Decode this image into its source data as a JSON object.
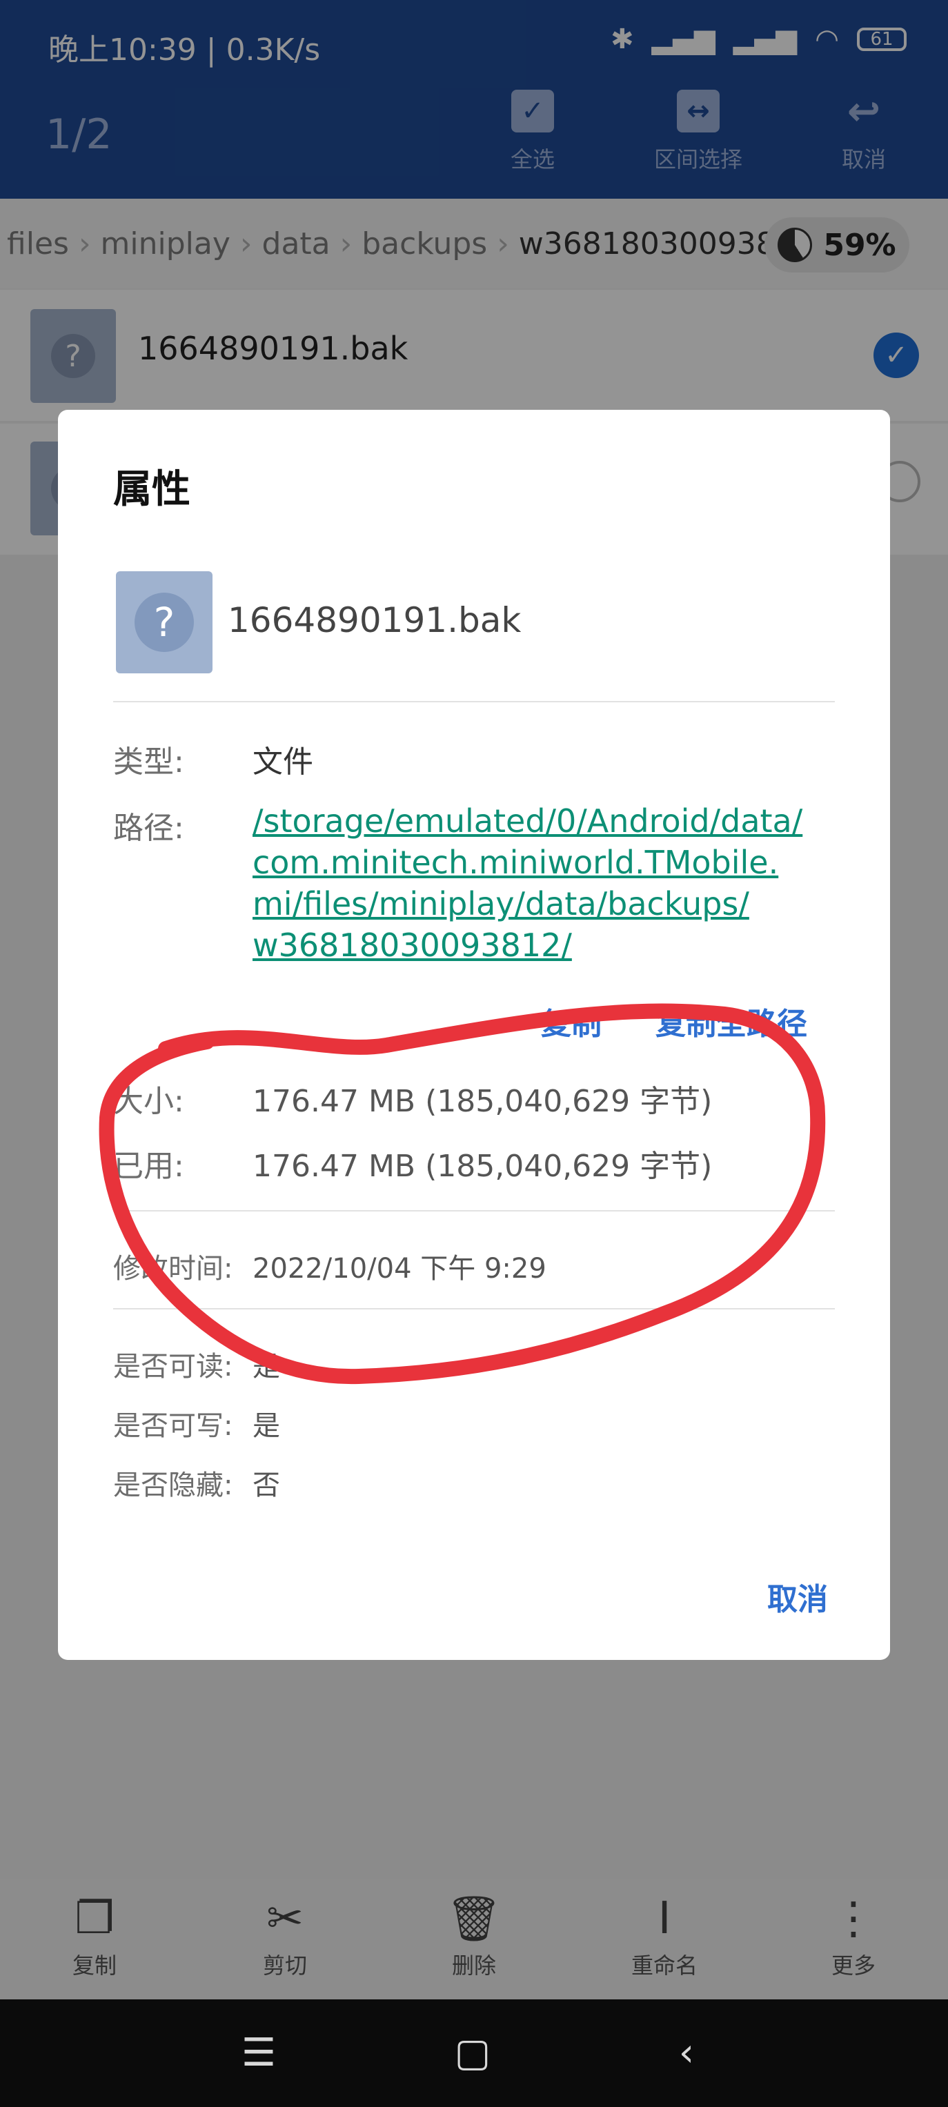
{
  "status_bar": {
    "time": "晚上10:39 | 0.3K/s",
    "battery": "61"
  },
  "header": {
    "selection_count": "1/2",
    "actions": [
      {
        "label": "全选"
      },
      {
        "label": "区间选择"
      },
      {
        "label": "取消"
      }
    ]
  },
  "breadcrumb": {
    "items": [
      "files",
      "miniplay",
      "data",
      "backups",
      "w36818030093812"
    ],
    "storage_percent": "59%"
  },
  "file_list": [
    {
      "name": "1664890191.bak",
      "selected": true
    }
  ],
  "dialog": {
    "title": "属性",
    "file_name": "1664890191.bak",
    "type_label": "类型:",
    "type_value": "文件",
    "path_label": "路径:",
    "path_lines": [
      "/storage/emulated/0/Android/data/",
      "com.minitech.miniworld.TMobile.",
      "mi/files/miniplay/data/backups/",
      "w36818030093812/"
    ],
    "copy_label": "复制",
    "copy_full_label": "复制全路径",
    "size_label": "大小:",
    "size_value": "176.47 MB (185,040,629 字节)",
    "used_label": "已用:",
    "used_value": "176.47 MB (185,040,629 字节)",
    "modified_label": "修改时间:",
    "modified_value": "2022/10/04 下午 9:29",
    "readable_label": "是否可读:",
    "readable_value": "是",
    "writable_label": "是否可写:",
    "writable_value": "是",
    "hidden_label": "是否隐藏:",
    "hidden_value": "否",
    "cancel_label": "取消"
  },
  "toolbar": [
    {
      "label": "复制"
    },
    {
      "label": "剪切"
    },
    {
      "label": "删除"
    },
    {
      "label": "重命名"
    },
    {
      "label": "更多"
    }
  ],
  "annotation_color": "#e8333b"
}
